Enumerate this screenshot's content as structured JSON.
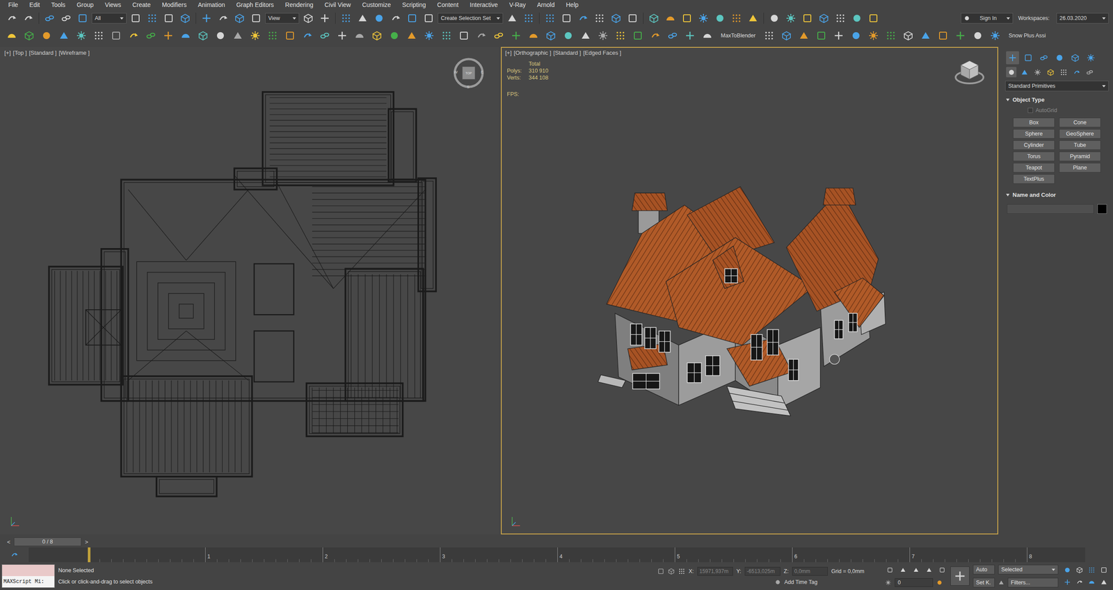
{
  "menu": [
    "File",
    "Edit",
    "Tools",
    "Group",
    "Views",
    "Create",
    "Modifiers",
    "Animation",
    "Graph Editors",
    "Rendering",
    "Civil View",
    "Customize",
    "Scripting",
    "Content",
    "Interactive",
    "V-Ray",
    "Arnold",
    "Help"
  ],
  "main_toolbar": {
    "selection_filter": "All",
    "reference_coordinate": "View",
    "named_selection": "Create Selection Set"
  },
  "account": {
    "sign_in": "Sign In",
    "workspaces_label": "Workspaces:",
    "workspace": "26.03.2020"
  },
  "second_toolbar": {
    "plugin_label": "MaxToBlender",
    "snow_label": "Snow Plus Assi"
  },
  "viewports": [
    {
      "kind": "wireframe",
      "labels": [
        "[+]",
        "[Top ]",
        "[Standard ]",
        "[Wireframe ]"
      ],
      "active": false,
      "compass": {
        "west": "W",
        "east": "E",
        "south": "S",
        "face": "TOP"
      }
    },
    {
      "kind": "shaded",
      "labels": [
        "[+]",
        "[Orthographic ]",
        "[Standard ]",
        "[Edged Faces ]"
      ],
      "active": true,
      "stats": {
        "header": "Total",
        "rows": [
          {
            "label": "Polys:",
            "value": "310 910"
          },
          {
            "label": "Verts:",
            "value": "344 108"
          }
        ],
        "fps": "FPS:"
      }
    }
  ],
  "command_panel": {
    "tabs": [
      {
        "selected": true
      },
      {
        "selected": false
      },
      {
        "selected": false
      },
      {
        "selected": false
      },
      {
        "selected": false
      },
      {
        "selected": false
      }
    ],
    "categories": [
      {
        "selected": true
      },
      {
        "selected": false
      },
      {
        "selected": false
      },
      {
        "selected": false
      },
      {
        "selected": false
      },
      {
        "selected": false
      },
      {
        "selected": false
      }
    ],
    "category": "Standard Primitives",
    "object_type": {
      "title": "Object Type",
      "expanded": true,
      "autogrid": {
        "label": "AutoGrid",
        "checked": false,
        "disabled": true
      },
      "buttons": [
        "Box",
        "Cone",
        "Sphere",
        "GeoSphere",
        "Cylinder",
        "Tube",
        "Torus",
        "Pyramid",
        "Teapot",
        "Plane",
        "TextPlus"
      ]
    },
    "name_color": {
      "title": "Name and Color",
      "expanded": true,
      "name": "",
      "swatch": "#000000"
    }
  },
  "time_slider": {
    "prev": "<",
    "value": "0 / 8",
    "next": ">"
  },
  "track_bar": {
    "key_at_start": true,
    "ticks": [
      "1",
      "2",
      "3",
      "4",
      "5",
      "6",
      "7",
      "8"
    ]
  },
  "status_bar": {
    "maxscript": "MAXScript Mi:",
    "selection": "None Selected",
    "prompt": "Click or click-and-drag to select objects",
    "coords": [
      {
        "axis": "X:",
        "value": "15971,937m",
        "disabled": true
      },
      {
        "axis": "Y:",
        "value": "-6513,025m",
        "disabled": true
      },
      {
        "axis": "Z:",
        "value": "0,0mm",
        "disabled": true
      }
    ],
    "grid": "Grid = 0,0mm",
    "time_tag": "Add Time Tag",
    "frame": "0",
    "auto_key": "Auto",
    "key_filter": "Selected",
    "set_key": "Set K.",
    "filters": "Filters..."
  }
}
